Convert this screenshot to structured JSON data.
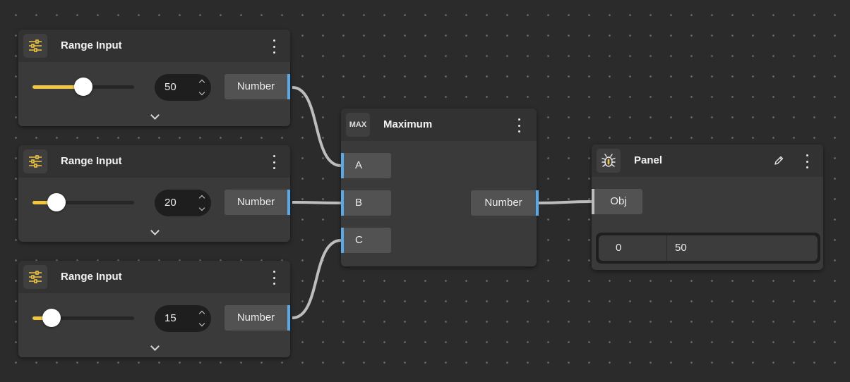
{
  "range_inputs": [
    {
      "title": "Range Input",
      "value": "50",
      "slider_fraction": 0.5,
      "output_label": "Number"
    },
    {
      "title": "Range Input",
      "value": "20",
      "slider_fraction": 0.2,
      "output_label": "Number"
    },
    {
      "title": "Range Input",
      "value": "15",
      "slider_fraction": 0.15,
      "output_label": "Number"
    }
  ],
  "maximum": {
    "icon_text": "MAX",
    "title": "Maximum",
    "inputs": [
      "A",
      "B",
      "C"
    ],
    "output_label": "Number"
  },
  "panel": {
    "title": "Panel",
    "input_label": "Obj",
    "rows": [
      {
        "index": "0",
        "value": "50"
      }
    ]
  },
  "colors": {
    "canvas": "#2b2b2b",
    "node": "#3a3a3a",
    "slider_accent": "#f2c641",
    "port_accent": "#5aa9e6",
    "wire": "#bdbdbd"
  },
  "icons": {
    "range_input": "sliders-icon",
    "panel": "bug-icon",
    "edit": "pencil-icon",
    "menu": "kebab-menu-icon"
  }
}
